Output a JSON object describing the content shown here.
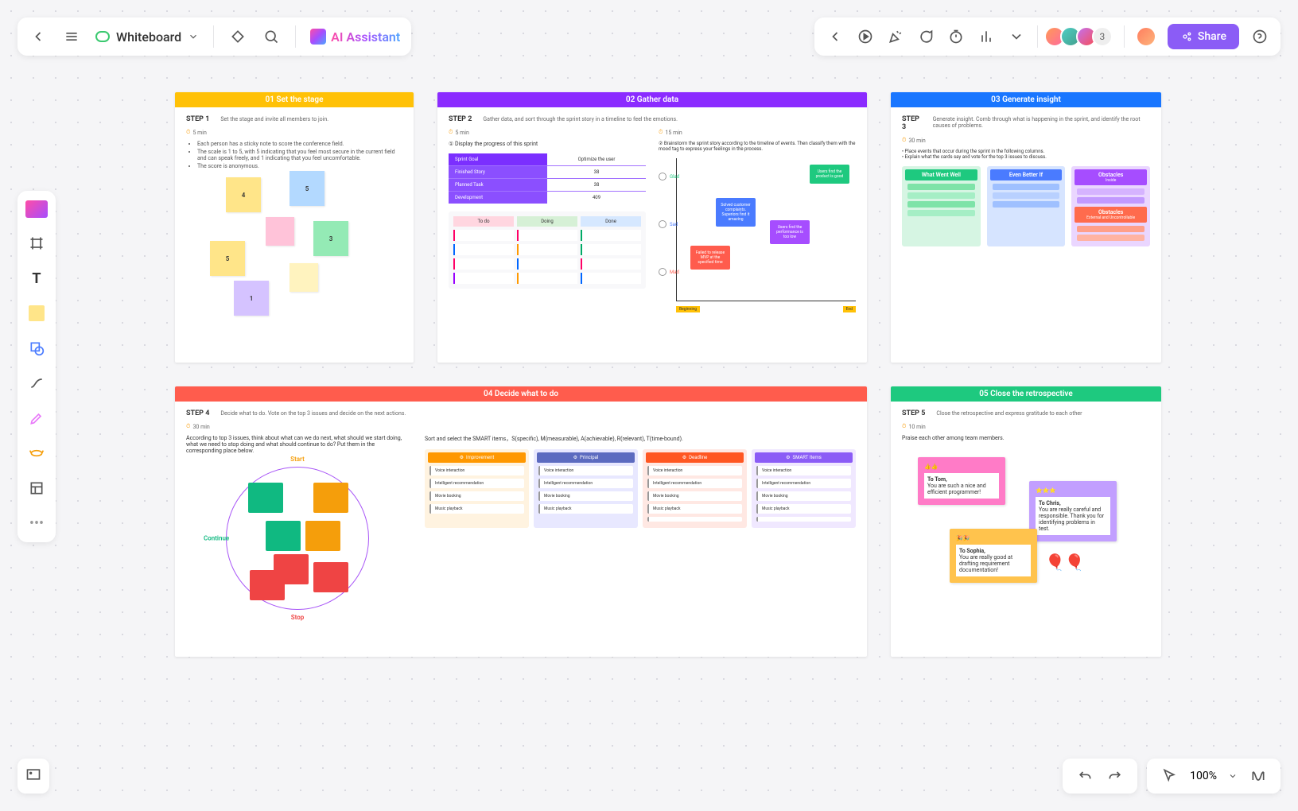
{
  "header": {
    "doc_title": "Whiteboard",
    "ai_label": "AI Assistant",
    "share_label": "Share",
    "avatar_extra": "3"
  },
  "bottombar": {
    "zoom": "100%"
  },
  "stages": {
    "s1": {
      "title": "01 Set the stage",
      "step": "STEP 1",
      "desc": "Set the stage and invite all members to join.",
      "time": "5 min",
      "bullets": [
        "Each person has a sticky note to score the conference field.",
        "The scale is 1 to 5, with 5 indicating that you feel most secure in the current field and can speak freely, and 1 indicating that you feel uncomfortable.",
        "The score is anonymous."
      ],
      "notes": {
        "n1": "4",
        "n2": "5",
        "n3": "3",
        "n4": "5",
        "n5": "1"
      }
    },
    "s2": {
      "title": "02 Gather data",
      "step": "STEP 2",
      "desc": "Gather data, and sort through the sprint story in a timeline to feel the emotions.",
      "time_a": "5 min",
      "time_b": "15 min",
      "inst_a": "① Display the progress of this sprint",
      "inst_b": "② Brainstorm the sprint story according to the timeline of events. Then classify them with the mood tag to express your feelings in the process.",
      "table": {
        "header": [
          "Sprint Goal",
          "Optimize the user"
        ],
        "rows": [
          [
            "Finished Story",
            "38"
          ],
          [
            "Planned Task",
            "38"
          ],
          [
            "Development",
            "409"
          ]
        ]
      },
      "kanban": {
        "heads": [
          "To do",
          "Doing",
          "Done"
        ]
      },
      "moods": {
        "glad": "Glad",
        "sad": "Sad",
        "mad": "Mad",
        "start": "Beginning",
        "end": "End"
      },
      "mood_notes": {
        "green": "Users find the product is good",
        "blue": "Solved customer complaints. Superiors find it amazing",
        "purple": "Users find the performance is too low",
        "red": "Failed to release MVP at the specified time"
      }
    },
    "s3": {
      "title": "03 Generate insight",
      "step": "STEP 3",
      "desc": "Generate insight. Comb through what is happening in the sprint, and identify the root causes of problems.",
      "time": "30 min",
      "inst1": "• Place events that occur during the sprint in the following columns.",
      "inst2": "• Explain what the cards say and vote for the top 3 issues to discuss.",
      "cols": {
        "c1": "What Went Well",
        "c2": "Even Better If",
        "c3": "Obstacles",
        "c3_sub": "Inside",
        "c4": "Obstacles",
        "c4_sub": "External and Uncontrollable"
      }
    },
    "s4": {
      "title": "04 Decide what to do",
      "step": "STEP 4",
      "desc": "Decide what to do. Vote on the top 3 issues and decide on the next actions.",
      "time": "30 min",
      "inst": "According to top 3 issues, think about what can we do next, what should we start doing, what we need to stop doing and what should continue to do? Put them in the corresponding place below.",
      "circle": {
        "start": "Start",
        "stop": "Stop",
        "continue": "Continue"
      },
      "smart_inst": "Sort and select the SMART items，S(specific), M(measurable), A(achievable), R(relevant), T(time-bound).",
      "smart_cols": {
        "c1": "Improvement",
        "c2": "Principal",
        "c3": "Deadline",
        "c4": "SMART Items"
      },
      "smart_items": [
        "Voice interaction",
        "Intelligent recommendation",
        "Movie booking",
        "Music playback"
      ]
    },
    "s5": {
      "title": "05 Close the retrospective",
      "step": "STEP 5",
      "desc": "Close the retrospective and express gratitude to each other",
      "time": "10 min",
      "inst": "Praise each other among team members.",
      "notes": {
        "n1": {
          "to": "To Tom,",
          "msg": "You are such a nice and efficient programmer!"
        },
        "n2": {
          "to": "To Chris,",
          "msg": "You are really careful and responsible. Thank you for identifying problems in test."
        },
        "n3": {
          "to": "To Sophia,",
          "msg": "You are really good at drafting requirement documentation!"
        }
      }
    }
  }
}
